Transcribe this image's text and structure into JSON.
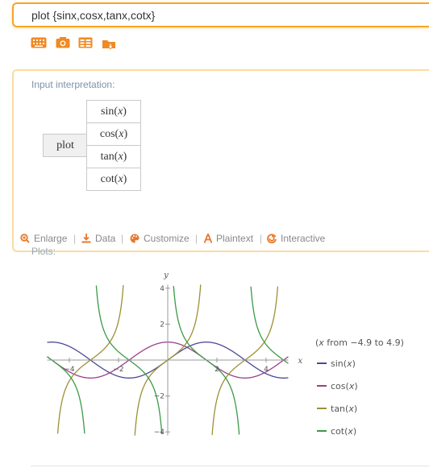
{
  "query": {
    "value": "plot {sinx,cosx,tanx,cotx}"
  },
  "toolbar_icons": [
    "keyboard-icon",
    "camera-icon",
    "grid-icon",
    "file-upload-icon"
  ],
  "input_pod": {
    "title": "Input interpretation:",
    "plot_label": "plot",
    "functions": [
      {
        "name": "sin",
        "arg": "x"
      },
      {
        "name": "cos",
        "arg": "x"
      },
      {
        "name": "tan",
        "arg": "x"
      },
      {
        "name": "cot",
        "arg": "x"
      }
    ]
  },
  "pod_actions": {
    "enlarge": "Enlarge",
    "data": "Data",
    "customize": "Customize",
    "plaintext": "Plaintext",
    "interactive": "Interactive"
  },
  "plots_pod": {
    "title": "Plots:"
  },
  "colors": {
    "accent": "#f5a623",
    "link_orange": "#e8792c"
  },
  "chart_data": {
    "type": "line",
    "xlabel": "x",
    "ylabel": "y",
    "xlim": [
      -4.9,
      4.9
    ],
    "ylim": [
      -4.2,
      4.2
    ],
    "x_ticks": [
      -4,
      -2,
      2,
      4
    ],
    "y_ticks": [
      -4,
      -2,
      2,
      4
    ],
    "x_range_note_prefix": "(",
    "x_range_note_var": "x",
    "x_range_note_suffix": " from −4.9 to 4.9)",
    "grid": false,
    "legend_position": "right",
    "series": [
      {
        "name": "sin",
        "arg": "x",
        "fn": "sin",
        "color": "#4b4893"
      },
      {
        "name": "cos",
        "arg": "x",
        "fn": "cos",
        "color": "#9a3e8a"
      },
      {
        "name": "tan",
        "arg": "x",
        "fn": "tan",
        "color": "#9c9034"
      },
      {
        "name": "cot",
        "arg": "x",
        "fn": "cot",
        "color": "#3a9a46"
      }
    ]
  }
}
